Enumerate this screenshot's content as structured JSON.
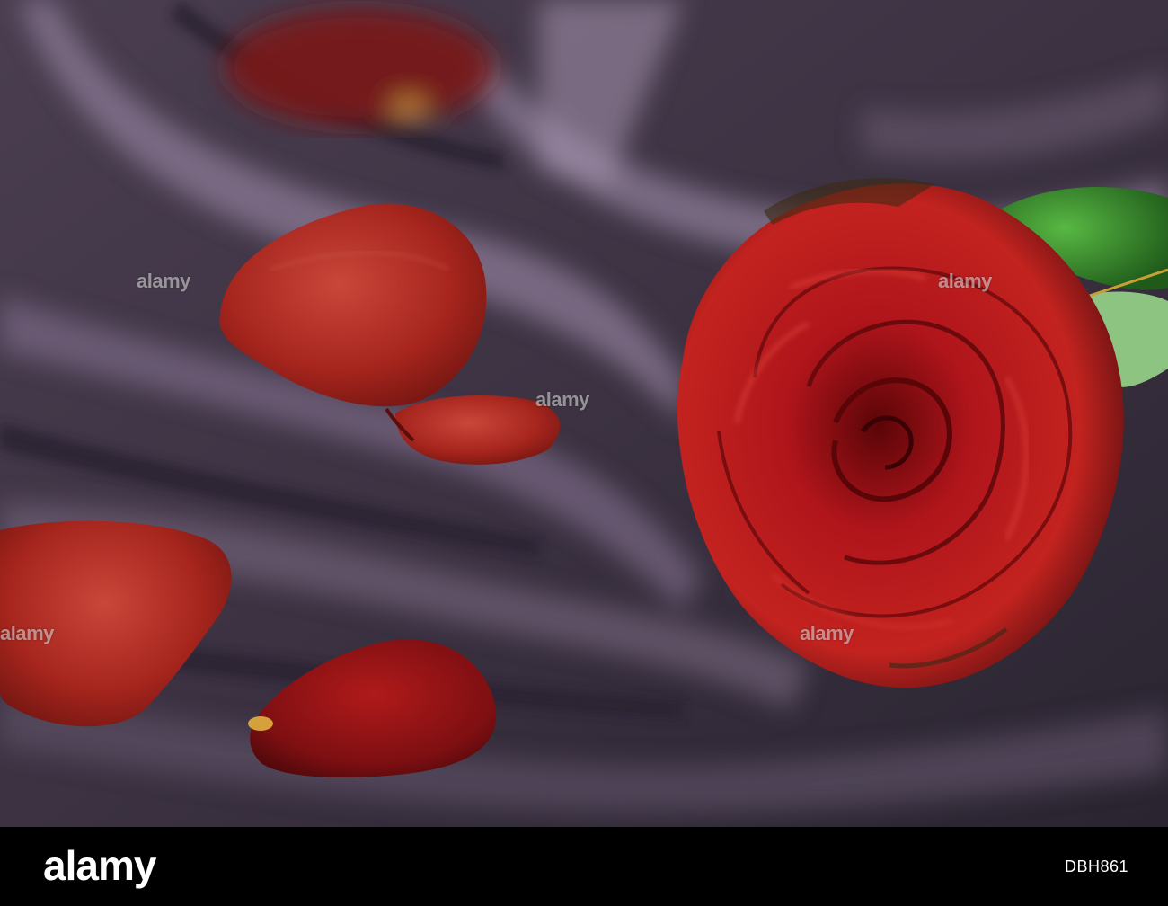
{
  "image": {
    "watermark_text": "alamy",
    "footer_logo": "alamy",
    "image_code": "DBH861"
  },
  "colors": {
    "fabric": "#3a3040",
    "fabric_highlight": "#8a7890",
    "rose_red": "#b3171c",
    "petal_red": "#a8241e",
    "leaf_green": "#3f9b2e",
    "footer_bg": "#000000"
  }
}
